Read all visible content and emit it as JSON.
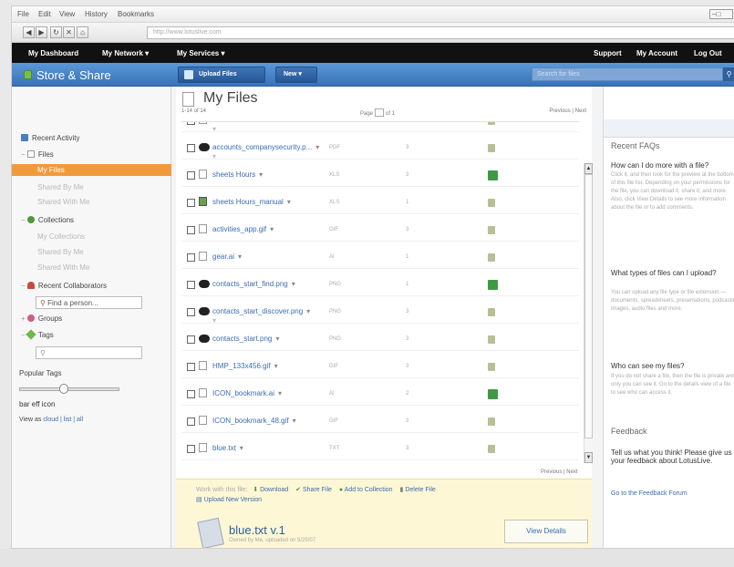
{
  "browser": {
    "menu": [
      "File",
      "Edit",
      "View",
      "History",
      "Bookmarks"
    ],
    "address": "http://www.lotuslive.com",
    "window_controls": "–□"
  },
  "topnav": {
    "left": [
      "My Dashboard",
      "My Network ▾",
      "My Services ▾"
    ],
    "right": [
      "Support",
      "My Account",
      "Log Out"
    ]
  },
  "app": {
    "name": "Store & Share",
    "upload_label": "Upload Files",
    "new_label": "New ▾",
    "search_placeholder": "Search for files",
    "search_icon": "search-icon"
  },
  "sidebar": {
    "recent_activity": "Recent Activity",
    "files": "Files",
    "my_files": "My Files",
    "shared_by_me": "Shared By Me",
    "shared_with_me": "Shared With Me",
    "collections": "Collections",
    "my_collections": "My Collections",
    "shared_by_me_2": "Shared By Me",
    "shared_with_me_2": "Shared With Me",
    "recent_collaborators": "Recent Collaborators",
    "find_person": "Find a person...",
    "groups": "Groups",
    "tags": "Tags",
    "tags_input": "",
    "popular_tags": "Popular Tags",
    "tag_cloud_item": "bar eff icon",
    "view_as_label": "View as",
    "view_as_options": "cloud | list | all"
  },
  "main": {
    "title": "My Files",
    "count": "1-14 of 14",
    "page_label": "Page",
    "page_of": "of 1",
    "prev_next": "Previous | Next",
    "rows": [
      {
        "name": "",
        "col1": "PNG",
        "col2": "1",
        "icon": "doc",
        "status": "share",
        "subline": "▾"
      },
      {
        "name": "accounts_companysecurity.p...",
        "col1": "PDF",
        "col2": "3",
        "icon": "dark",
        "status": "share",
        "subline": "▾"
      },
      {
        "name": "sheets Hours",
        "col1": "XLS",
        "col2": "3",
        "icon": "doc",
        "status": "green",
        "subline": ""
      },
      {
        "name": "sheets Hours_manual",
        "col1": "XLS",
        "col2": "1",
        "icon": "green",
        "status": "share",
        "subline": ""
      },
      {
        "name": "activities_app.gif",
        "col1": "GIF",
        "col2": "3",
        "icon": "doc",
        "status": "share",
        "subline": ""
      },
      {
        "name": "gear.ai",
        "col1": "AI",
        "col2": "1",
        "icon": "doc",
        "status": "share",
        "subline": ""
      },
      {
        "name": "contacts_start_find.png",
        "col1": "PNG",
        "col2": "1",
        "icon": "dark",
        "status": "green",
        "subline": ""
      },
      {
        "name": "contacts_start_discover.png",
        "col1": "PNG",
        "col2": "3",
        "icon": "dark",
        "status": "share",
        "subline": "▾"
      },
      {
        "name": "contacts_start.png",
        "col1": "PNG",
        "col2": "3",
        "icon": "dark",
        "status": "share",
        "subline": ""
      },
      {
        "name": "HMP_133x456.gif",
        "col1": "GIF",
        "col2": "3",
        "icon": "doc",
        "status": "share",
        "subline": ""
      },
      {
        "name": "ICON_bookmark.ai",
        "col1": "AI",
        "col2": "2",
        "icon": "doc",
        "status": "green",
        "subline": ""
      },
      {
        "name": "ICON_bookmark_48.gif",
        "col1": "GIF",
        "col2": "3",
        "icon": "doc",
        "status": "share",
        "subline": ""
      },
      {
        "name": "blue.txt",
        "col1": "TXT",
        "col2": "3",
        "icon": "doc",
        "status": "share",
        "subline": ""
      }
    ],
    "scroll_up": "▲",
    "scroll_down": "▼"
  },
  "detail": {
    "prefix": "Work with this file:",
    "actions": [
      "Download",
      "Share File",
      "Add to Collection",
      "Delete File",
      "Upload New Version"
    ],
    "file_title": "blue.txt v.1",
    "file_sub": "Owned by Me, uploaded on 5/25/07",
    "view_details": "View Details"
  },
  "right": {
    "recent_faqs": "Recent FAQs",
    "q1": "How can I do more with a file?",
    "t1": "Click it, and then look for the preview at the bottom of this file list. Depending on your permissions for the file, you can download it, share it, and more. Also, click View Details to see more information about the file or to add comments.",
    "q2": "What types of files can I upload?",
    "t2": "You can upload any file type or file extension — documents, spreadsheets, presentations, podcasts, images, audio files and more.",
    "q3": "Who can see my files?",
    "t3": "If you do not share a file, then the file is private and only you can see it. Go to the details view of a file to see who can access it.",
    "feedback": "Feedback",
    "feedback_text": "Tell us what you think! Please give us your feedback about LotusLive.",
    "feedback_link": "Go to the Feedback Forum"
  },
  "colors": {
    "accent": "#f19a3c",
    "appbar": "#3a72b8",
    "link": "#3b6cb2"
  }
}
